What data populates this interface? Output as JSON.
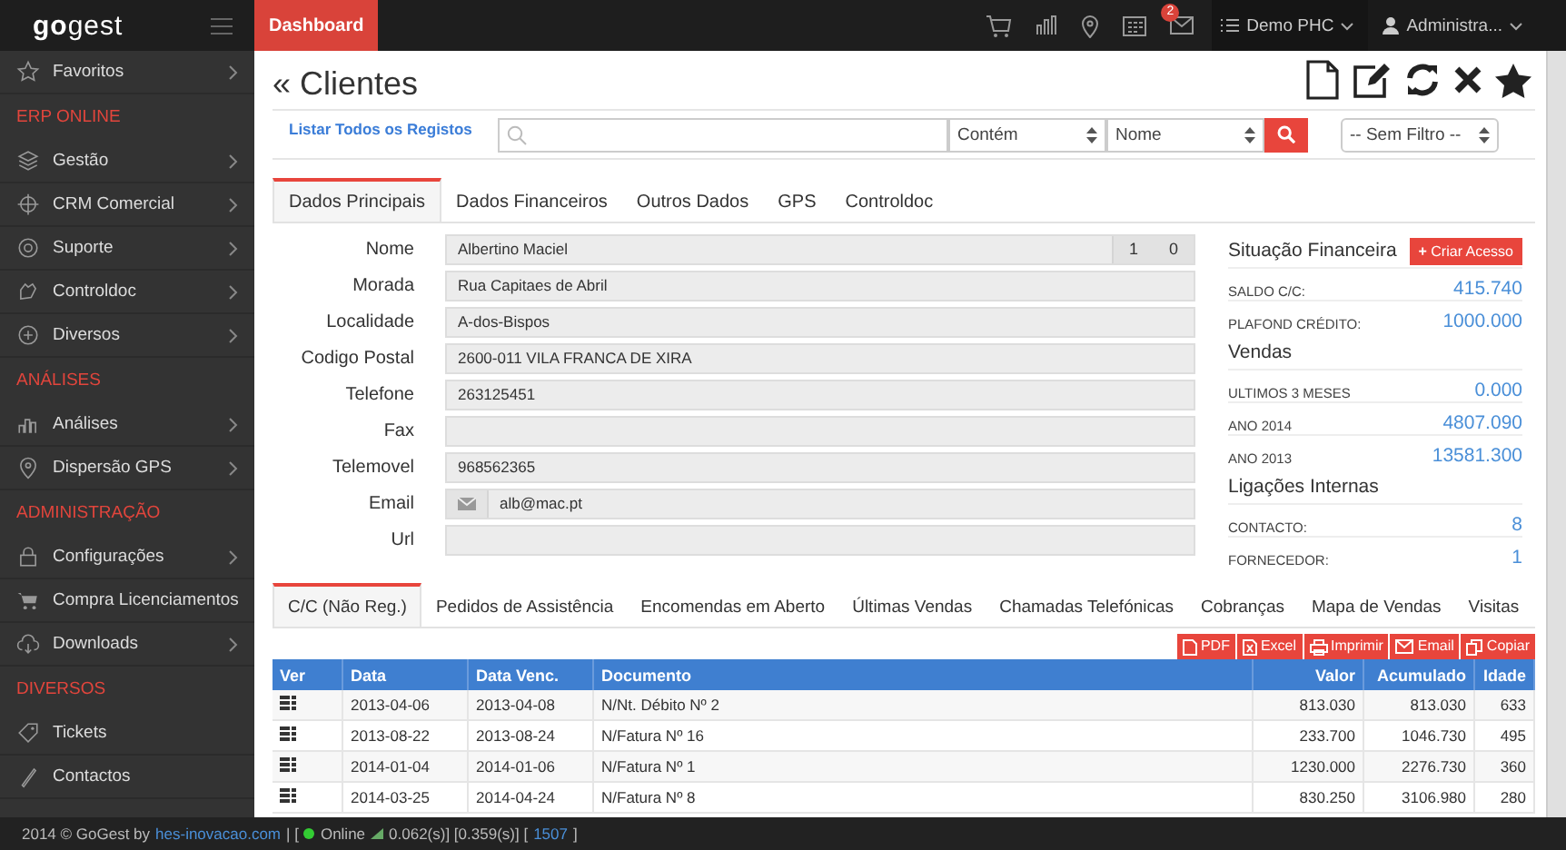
{
  "topbar": {
    "logo_bold": "go",
    "logo_light": "gest",
    "tab": "Dashboard",
    "badge": "2",
    "company": "Demo PHC",
    "user": "Administra..."
  },
  "sidebar": {
    "items": [
      {
        "kind": "item",
        "label": "Favoritos",
        "submenu": true
      },
      {
        "kind": "header",
        "label": "ERP ONLINE"
      },
      {
        "kind": "item",
        "label": "Gestão",
        "submenu": true
      },
      {
        "kind": "item",
        "label": "CRM Comercial",
        "submenu": true
      },
      {
        "kind": "item",
        "label": "Suporte",
        "submenu": true
      },
      {
        "kind": "item",
        "label": "Controldoc",
        "submenu": true
      },
      {
        "kind": "item",
        "label": "Diversos",
        "submenu": true
      },
      {
        "kind": "header",
        "label": "ANÁLISES"
      },
      {
        "kind": "item",
        "label": "Análises",
        "submenu": true
      },
      {
        "kind": "item",
        "label": "Dispersão GPS",
        "submenu": true
      },
      {
        "kind": "header",
        "label": "ADMINISTRAÇÃO"
      },
      {
        "kind": "item",
        "label": "Configurações",
        "submenu": true
      },
      {
        "kind": "item",
        "label": "Compra Licenciamentos",
        "submenu": false
      },
      {
        "kind": "item",
        "label": "Downloads",
        "submenu": true
      },
      {
        "kind": "header",
        "label": "DIVERSOS"
      },
      {
        "kind": "item",
        "label": "Tickets",
        "submenu": false
      },
      {
        "kind": "item",
        "label": "Contactos",
        "submenu": false
      }
    ]
  },
  "page": {
    "back": "«",
    "title": "Clientes"
  },
  "search": {
    "link": "Listar Todos os Registos",
    "operator": "Contém",
    "field": "Nome",
    "filter": "-- Sem Filtro --"
  },
  "tabs": [
    {
      "label": "Dados Principais",
      "selected": true
    },
    {
      "label": "Dados Financeiros",
      "selected": false
    },
    {
      "label": "Outros Dados",
      "selected": false
    },
    {
      "label": "GPS",
      "selected": false
    },
    {
      "label": "Controldoc",
      "selected": false
    }
  ],
  "fields": [
    {
      "label": "Nome",
      "value": "Albertino Maciel",
      "kind": "counter",
      "counters": [
        "1",
        "0"
      ]
    },
    {
      "label": "Morada",
      "value": "Rua Capitaes de Abril",
      "kind": "text"
    },
    {
      "label": "Localidade",
      "value": "A-dos-Bispos",
      "kind": "text"
    },
    {
      "label": "Codigo Postal",
      "value": "2600-011 VILA FRANCA DE XIRA",
      "kind": "text"
    },
    {
      "label": "Telefone",
      "value": "263125451",
      "kind": "text"
    },
    {
      "label": "Fax",
      "kind": "text"
    },
    {
      "label": "Telemovel",
      "value": "968562365",
      "kind": "text"
    },
    {
      "label": "Email",
      "value": "alb@mac.pt",
      "kind": "email"
    },
    {
      "label": "Url",
      "kind": "text"
    }
  ],
  "summary": {
    "button_plus": "+",
    "button": "Criar Acesso",
    "sections": [
      {
        "title": "Situação Financeira",
        "rows": [
          {
            "label": "SALDO C/C:",
            "value": "415.740"
          },
          {
            "label": "PLAFOND CRÉDITO:",
            "value": "1000.000"
          }
        ]
      },
      {
        "title": "Vendas",
        "rows": [
          {
            "label": "ULTIMOS 3 MESES",
            "value": "0.000"
          },
          {
            "label": "ANO 2014",
            "value": "4807.090"
          },
          {
            "label": "ANO 2013",
            "value": "13581.300"
          }
        ]
      },
      {
        "title": "Ligações Internas",
        "rows": [
          {
            "label": "CONTACTO:",
            "value": "8"
          },
          {
            "label": "FORNECEDOR:",
            "value": "1"
          }
        ]
      }
    ]
  },
  "detail_tabs": [
    {
      "label": "C/C (Não Reg.)",
      "selected": true
    },
    {
      "label": "Pedidos de Assistência",
      "selected": false
    },
    {
      "label": "Encomendas em Aberto",
      "selected": false
    },
    {
      "label": "Últimas Vendas",
      "selected": false
    },
    {
      "label": "Chamadas Telefónicas",
      "selected": false
    },
    {
      "label": "Cobranças",
      "selected": false
    },
    {
      "label": "Mapa de Vendas",
      "selected": false
    },
    {
      "label": "Visitas",
      "selected": false
    }
  ],
  "export_buttons": [
    "PDF",
    "Excel",
    "Imprimir",
    "Email",
    "Copiar"
  ],
  "table": {
    "columns": [
      {
        "label": "Ver",
        "numeric": false
      },
      {
        "label": "Data",
        "numeric": false
      },
      {
        "label": "Data Venc.",
        "numeric": false
      },
      {
        "label": "Documento",
        "numeric": false
      },
      {
        "label": "Valor",
        "numeric": true
      },
      {
        "label": "Acumulado",
        "numeric": true
      },
      {
        "label": "Idade",
        "numeric": true
      }
    ],
    "rows": [
      [
        "",
        "2013-04-06",
        "2013-04-08",
        "N/Nt. Débito Nº 2",
        "813.030",
        "813.030",
        "633"
      ],
      [
        "",
        "2013-08-22",
        "2013-08-24",
        "N/Fatura Nº 16",
        "233.700",
        "1046.730",
        "495"
      ],
      [
        "",
        "2014-01-04",
        "2014-01-06",
        "N/Fatura Nº 1",
        "1230.000",
        "2276.730",
        "360"
      ],
      [
        "",
        "2014-03-25",
        "2014-04-24",
        "N/Fatura Nº 8",
        "830.250",
        "3106.980",
        "280"
      ]
    ]
  },
  "footer": {
    "prefix": "2014 © GoGest by",
    "link": "hes-inovacao.com",
    "sep": "| [",
    "status": "Online",
    "timing": "0.062(s)] [0.359(s)] [",
    "count": "1507",
    "end": "]"
  }
}
